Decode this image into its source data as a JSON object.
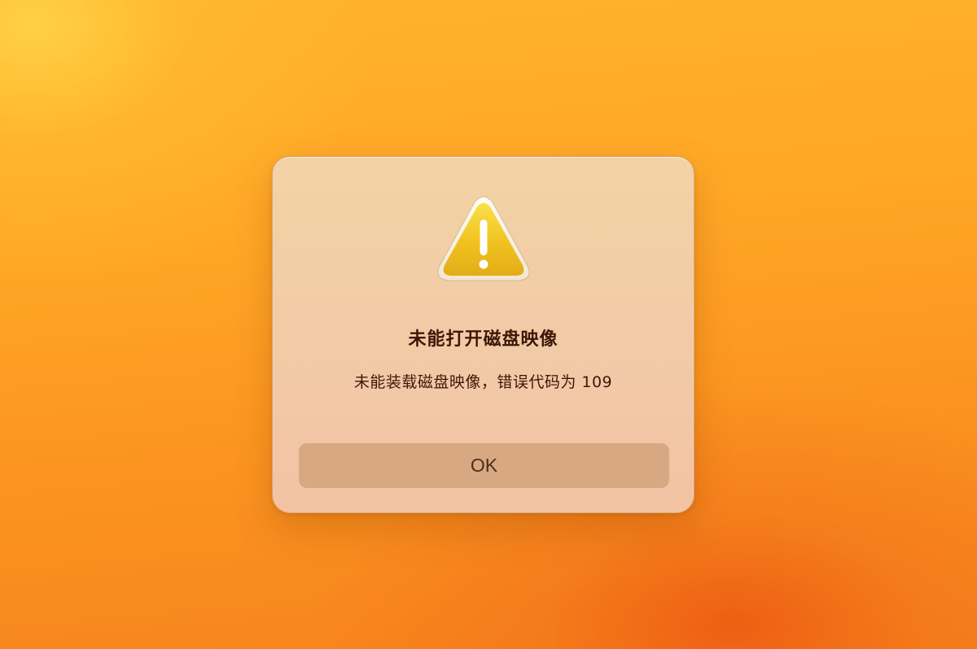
{
  "alert": {
    "icon": "warning-icon",
    "title": "未能打开磁盘映像",
    "message": "未能装载磁盘映像，错误代码为 109",
    "ok_label": "OK"
  },
  "colors": {
    "background_top": "#ffb22e",
    "background_bottom": "#f7821c",
    "dialog_background": "#f2ccA6",
    "button_background": "#d8a882",
    "text": "#3d1808",
    "warning_yellow": "#f2c81e"
  }
}
